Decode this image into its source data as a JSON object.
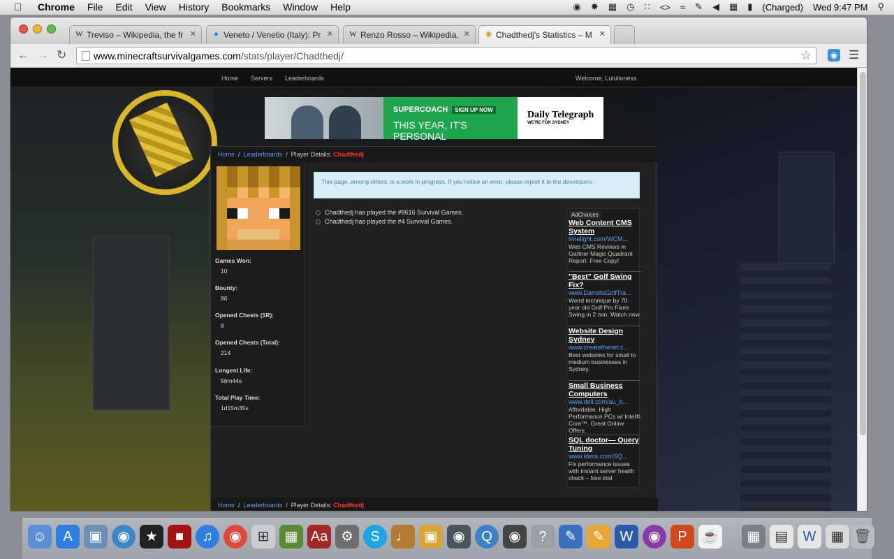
{
  "menubar": {
    "app": "Chrome",
    "menus": [
      "File",
      "Edit",
      "View",
      "History",
      "Bookmarks",
      "Window",
      "Help"
    ],
    "battery": "(Charged)",
    "clock": "Wed 9:47 PM"
  },
  "tabs": [
    {
      "label": "Treviso – Wikipedia, the fr",
      "favicon": "W"
    },
    {
      "label": "Veneto / Venetio (Italy): Pr",
      "favicon": "globe"
    },
    {
      "label": "Renzo Rosso – Wikipedia,",
      "favicon": "W"
    },
    {
      "label": "Chadthedj's Statistics – M",
      "favicon": "mockingjay"
    }
  ],
  "address": {
    "host": "www.minecraftsurvivalgames.com",
    "path": "/stats/player/Chadthedj/"
  },
  "site_nav": {
    "links": [
      "Home",
      "Servers",
      "Leaderboards"
    ],
    "welcome": "Welcome, Lululioness."
  },
  "banner": {
    "brand": "SUPERCOACH",
    "signup": "SIGN UP NOW",
    "tagline": "THIS YEAR, IT'S PERSONAL",
    "paper": "Daily Telegraph",
    "paper_sub": "WE'RE FOR SYDNEY"
  },
  "breadcrumb": {
    "home": "Home",
    "leaderboards": "Leaderboards",
    "details": "Player Details:",
    "player": "Chadthedj"
  },
  "stats": [
    {
      "label": "Games Won:",
      "value": "10"
    },
    {
      "label": "Bounty:",
      "value": "86"
    },
    {
      "label": "Opened Chests (1R):",
      "value": "8"
    },
    {
      "label": "Opened Chests (Total):",
      "value": "214"
    },
    {
      "label": "Longest Life:",
      "value": "56m44s"
    },
    {
      "label": "Total Play Time:",
      "value": "1d15m35s"
    }
  ],
  "notice": "This page, among others, is a work in progress. If you notice an error, please report it to the developers.",
  "played": [
    "Chadthedj has played the #8616 Survival Games.",
    "Chadthedj has played the #4 Survival Games."
  ],
  "adchoices": "AdChoices",
  "ads": [
    {
      "title": "Web Content CMS System",
      "url": "limelight.com/WCM...",
      "desc": "Web CMS Reviews in Gartner Magic Quadrant Report. Free Copy!"
    },
    {
      "title": "\"Best\" Golf Swing Fix?",
      "url": "www.DarrellsGolfTra...",
      "desc": "Weird technique by 70 year old Golf Pro Fixes Swing in 2 min. Watch now"
    },
    {
      "title": "Website Design Sydney",
      "url": "www.createthenet.c...",
      "desc": "Best websites for small to medium businesses in Sydney."
    },
    {
      "title": "Small Business Computers",
      "url": "www.dell.com/au_b...",
      "desc": "Affordable, High Performance PCs w/ Intel® Core™. Great Online Offers."
    },
    {
      "title": "SQL doctor— Query Tuning",
      "url": "www.Idera.com/SQ...",
      "desc": "Fix performance issues with instant server health check – free trial"
    }
  ]
}
